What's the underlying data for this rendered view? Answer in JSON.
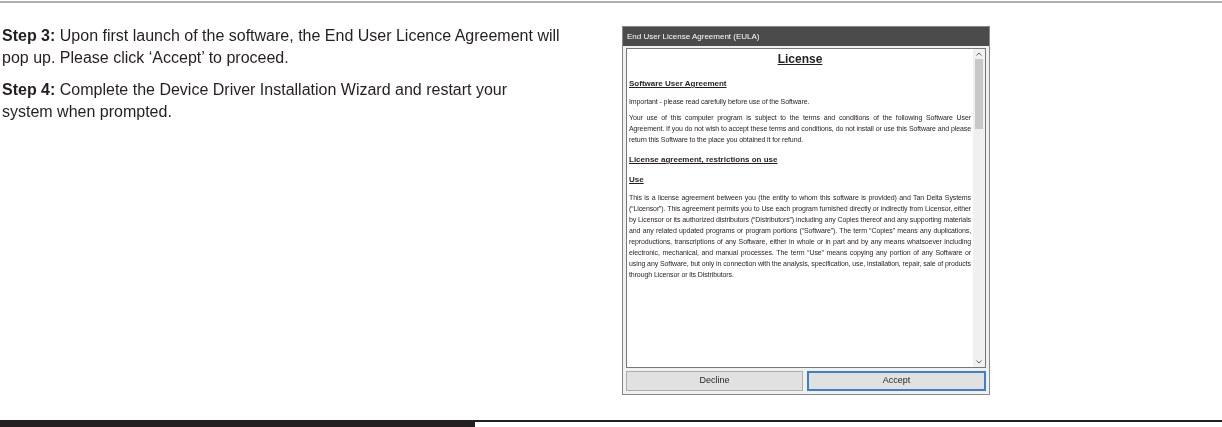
{
  "steps": [
    {
      "text": "**Step 3:** Upon first launch of the software, the End User Licence Agreement will pop up. Please click ‘Accept’ to proceed."
    },
    {
      "text": "**Step 4:** Complete the Device Driver Installation Wizard and restart your system when prompted."
    }
  ],
  "dialog": {
    "title": "End User License Agreement (EULA)",
    "heading": "License",
    "blocks": [
      {
        "kind": "heading",
        "text": "Software User Agreement"
      },
      {
        "kind": "paragraph",
        "text": "Important - please read carefully before use of the Software."
      },
      {
        "kind": "paragraph",
        "text": "Your use of this computer program is subject to the terms and conditions of the following Software User Agreement. If you do not wish to accept these terms and conditions, do not install or use this Software and please return this Software to the place you obtained it for refund."
      },
      {
        "kind": "heading",
        "text": "License agreement, restrictions on use"
      },
      {
        "kind": "heading",
        "text": "Use"
      },
      {
        "kind": "paragraph",
        "text": "This is a license agreement between you (the entity to whom this software is provided) and Tan Delta Systems (“Licensor”). This agreement permits you to Use each program furnished directly or indirectly from Licensor, either by Licensor or its authorized distributors (“Distributors”) including any Copies thereof and any supporting materials and any related updated programs or program portions (“Software”). The term “Copies” means any duplications, reproductions, transcriptions of any Software, either in whole or in part and by any means whatsoever including electronic, mechanical, and manual processes. The term “Use” means copying any portion of any Software or using any Software, but only in connection with the analysis, specification, use, installation, repair, sale of products through Licensor or its Distributors."
      }
    ],
    "buttons": [
      {
        "label": "Decline",
        "selected": false
      },
      {
        "label": "Accept",
        "selected": true
      }
    ]
  }
}
